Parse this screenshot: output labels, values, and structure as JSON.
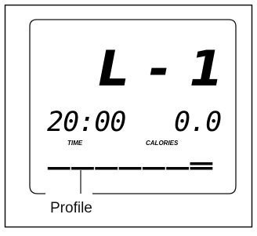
{
  "display": {
    "program": "L - 1",
    "time": {
      "value": "20:00",
      "label": "TIME"
    },
    "calories": {
      "value": "0.0",
      "label": "CALORIES"
    },
    "profile_label": "Profile",
    "profile_levels": [
      1,
      1,
      1,
      1,
      1,
      1,
      2
    ]
  }
}
